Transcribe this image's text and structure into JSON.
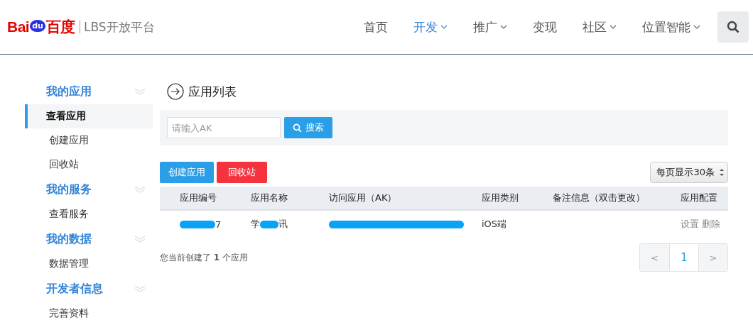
{
  "logo": {
    "brand_latin_1": "Bai",
    "brand_paw": "du",
    "brand_cn": "百度",
    "product": "LBS开放平台"
  },
  "nav": [
    {
      "label": "首页",
      "selected": false,
      "dropdown": false
    },
    {
      "label": "开发",
      "selected": true,
      "dropdown": true
    },
    {
      "label": "推广",
      "selected": false,
      "dropdown": true
    },
    {
      "label": "变现",
      "selected": false,
      "dropdown": false
    },
    {
      "label": "社区",
      "selected": false,
      "dropdown": true
    },
    {
      "label": "位置智能",
      "selected": false,
      "dropdown": true
    }
  ],
  "sidebar": [
    {
      "title": "我的应用",
      "items": [
        {
          "label": "查看应用",
          "selected": true
        },
        {
          "label": "创建应用",
          "selected": false
        },
        {
          "label": "回收站",
          "selected": false
        }
      ]
    },
    {
      "title": "我的服务",
      "items": [
        {
          "label": "查看服务",
          "selected": false
        }
      ]
    },
    {
      "title": "我的数据",
      "items": [
        {
          "label": "数据管理",
          "selected": false
        }
      ]
    },
    {
      "title": "开发者信息",
      "items": [
        {
          "label": "完善资料",
          "selected": false
        }
      ]
    }
  ],
  "page_title": "应用列表",
  "search": {
    "placeholder": "请输入AK",
    "button": "搜索"
  },
  "actions": {
    "create": "创建应用",
    "recycle": "回收站",
    "page_size": "每页显示30条"
  },
  "table": {
    "columns": [
      "应用编号",
      "应用名称",
      "访问应用（AK）",
      "应用类别",
      "备注信息（双击更改）",
      "应用配置"
    ],
    "rows": [
      {
        "id_prefix": "",
        "id_suffix": "7",
        "name_prefix": "学",
        "name_suffix": "讯",
        "ak": "",
        "category": "iOS端",
        "actions": [
          "设置",
          "删除"
        ]
      }
    ]
  },
  "summary": {
    "before": "您当前创建了",
    "count": "1",
    "after": "个应用"
  },
  "pagination": {
    "prev": "<",
    "pages": [
      {
        "label": "1",
        "selected": true
      }
    ],
    "next": ">"
  }
}
